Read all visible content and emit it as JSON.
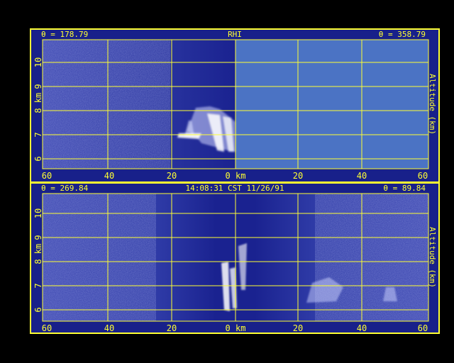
{
  "top_panel": {
    "left_angle": "θ = 178.79",
    "title": "RHI",
    "right_angle": "θ = 358.79",
    "y_ticks": [
      "6",
      "7",
      "8",
      "9",
      "10"
    ],
    "y_unit": "km",
    "x_ticks": [
      "60",
      "40",
      "20",
      "0 km",
      "20",
      "40",
      "60"
    ],
    "right_axis_label": "Altitude (km)",
    "unscanned_color": "#4b73c4"
  },
  "bottom_panel": {
    "left_angle": "θ = 269.84",
    "timestamp": "14:08:31 CST 11/26/91",
    "right_angle": "θ = 89.84",
    "y_ticks": [
      "6",
      "7",
      "8",
      "9",
      "10"
    ],
    "y_unit": "km",
    "x_ticks": [
      "60",
      "40",
      "20",
      "0 km",
      "20",
      "40",
      "60"
    ],
    "right_axis_label": "Altitude (km)"
  },
  "colors": {
    "frame": "#ffff33",
    "background": "#18208a",
    "echo": "#ffffff"
  }
}
